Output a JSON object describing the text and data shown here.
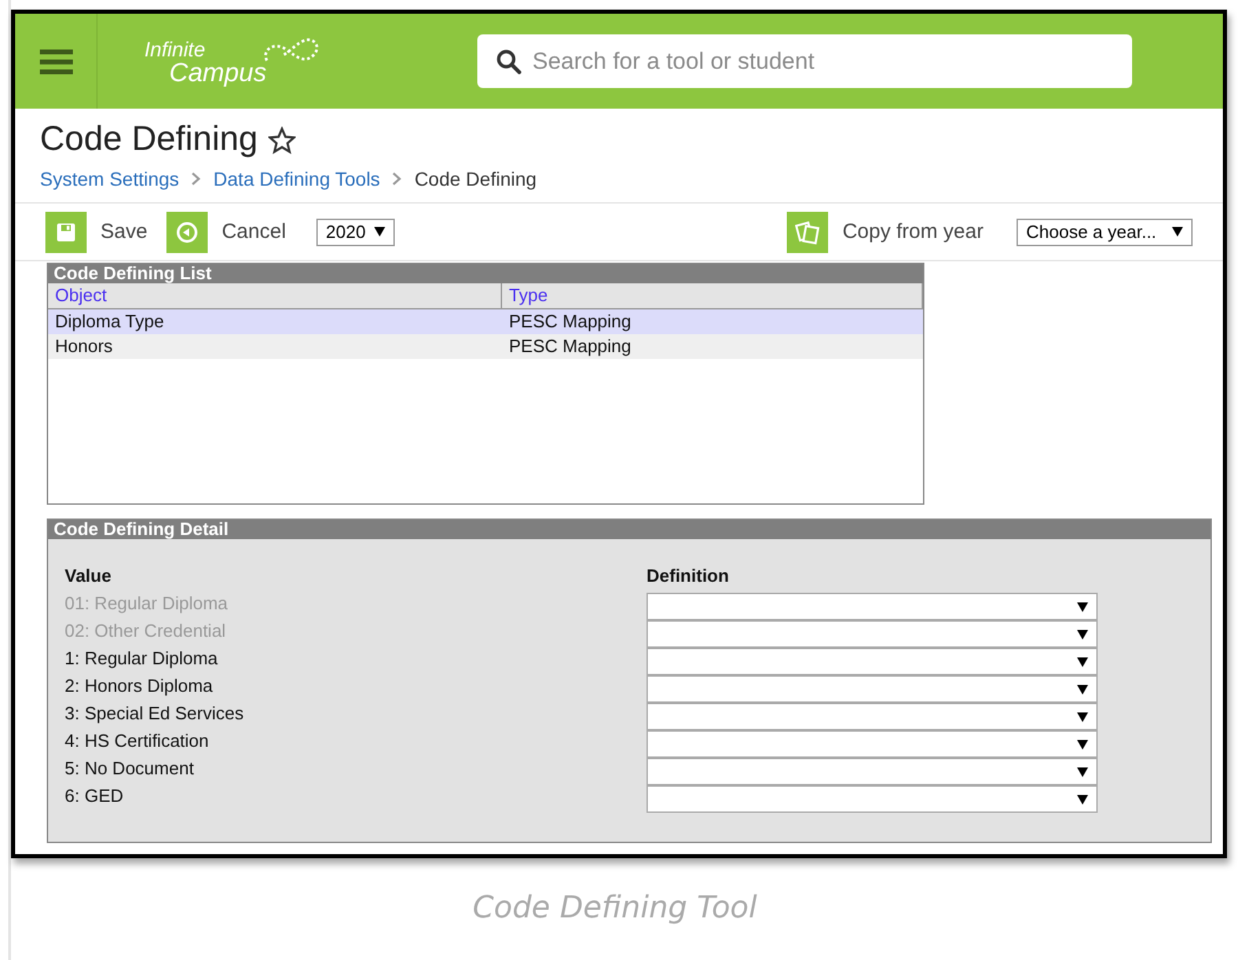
{
  "header": {
    "logo": {
      "line_1": "Infinite",
      "line_2": "Campus"
    },
    "search": {
      "placeholder": "Search for a tool or student"
    }
  },
  "page": {
    "title": "Code Defining",
    "favorite": false,
    "breadcrumb": [
      {
        "label": "System Settings",
        "link": true
      },
      {
        "label": "Data Defining Tools",
        "link": true
      },
      {
        "label": "Code Defining",
        "link": false
      }
    ]
  },
  "toolbar": {
    "save": "Save",
    "cancel": "Cancel",
    "year": "2020",
    "copy_label": "Copy from year",
    "copy_select": "Choose a year..."
  },
  "list": {
    "title": "Code Defining List",
    "columns": [
      "Object",
      "Type"
    ],
    "rows": [
      {
        "cells": [
          "Diploma Type",
          "PESC Mapping"
        ],
        "selected": true
      },
      {
        "cells": [
          "Honors",
          "PESC Mapping"
        ],
        "selected": false
      }
    ]
  },
  "detail": {
    "title": "Code Defining Detail",
    "columns": [
      "Value",
      "Definition"
    ],
    "rows": [
      {
        "value": "01: Regular Diploma",
        "disabled": true
      },
      {
        "value": "02: Other Credential",
        "disabled": true
      },
      {
        "value": "1: Regular Diploma",
        "disabled": false
      },
      {
        "value": "2: Honors Diploma",
        "disabled": false
      },
      {
        "value": "3: Special Ed Services",
        "disabled": false
      },
      {
        "value": "4: HS Certification",
        "disabled": false
      },
      {
        "value": "5: No Document",
        "disabled": false
      },
      {
        "value": "6: GED",
        "disabled": false
      }
    ]
  },
  "caption": "Code Defining Tool"
}
